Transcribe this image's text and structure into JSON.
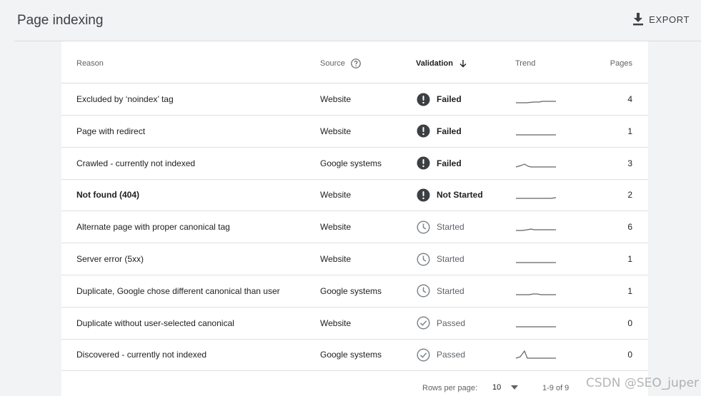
{
  "header": {
    "title": "Page indexing",
    "export_label": "EXPORT"
  },
  "table": {
    "columns": {
      "reason": "Reason",
      "source": "Source",
      "validation": "Validation",
      "trend": "Trend",
      "pages": "Pages"
    },
    "rows": [
      {
        "reason": "Excluded by ‘noindex’ tag",
        "source": "Website",
        "validation": "Failed",
        "pages": "4",
        "bold": false,
        "status": "failed",
        "trend": "excluded"
      },
      {
        "reason": "Page with redirect",
        "source": "Website",
        "validation": "Failed",
        "pages": "1",
        "bold": false,
        "status": "failed",
        "trend": "flat"
      },
      {
        "reason": "Crawled - currently not indexed",
        "source": "Google systems",
        "validation": "Failed",
        "pages": "3",
        "bold": false,
        "status": "failed",
        "trend": "bump"
      },
      {
        "reason": "Not found (404)",
        "source": "Website",
        "validation": "Not Started",
        "pages": "2",
        "bold": true,
        "status": "failed",
        "trend": "rise-end"
      },
      {
        "reason": "Alternate page with proper canonical tag",
        "source": "Website",
        "validation": "Started",
        "pages": "6",
        "bold": false,
        "status": "started",
        "trend": "wave"
      },
      {
        "reason": "Server error (5xx)",
        "source": "Website",
        "validation": "Started",
        "pages": "1",
        "bold": false,
        "status": "started",
        "trend": "flat"
      },
      {
        "reason": "Duplicate, Google chose different canonical than user",
        "source": "Google systems",
        "validation": "Started",
        "pages": "1",
        "bold": false,
        "status": "started",
        "trend": "small-bump"
      },
      {
        "reason": "Duplicate without user-selected canonical",
        "source": "Website",
        "validation": "Passed",
        "pages": "0",
        "bold": false,
        "status": "passed",
        "trend": "flat"
      },
      {
        "reason": "Discovered - currently not indexed",
        "source": "Google systems",
        "validation": "Passed",
        "pages": "0",
        "bold": false,
        "status": "passed",
        "trend": "spike"
      }
    ]
  },
  "footer": {
    "rows_per_page_label": "Rows per page:",
    "rows_per_page_value": "10",
    "range": "1-9 of 9"
  },
  "watermark": "CSDN @SEO_juper",
  "colors": {
    "failed_icon": "#3c4043",
    "muted_icon": "#80868b",
    "trend_line": "#5f6368"
  },
  "icons": {
    "export": "download-icon",
    "help": "help-circle-icon",
    "sort": "arrow-down-icon",
    "failed": "exclamation-circle-icon",
    "started": "clock-icon",
    "passed": "check-circle-icon"
  }
}
